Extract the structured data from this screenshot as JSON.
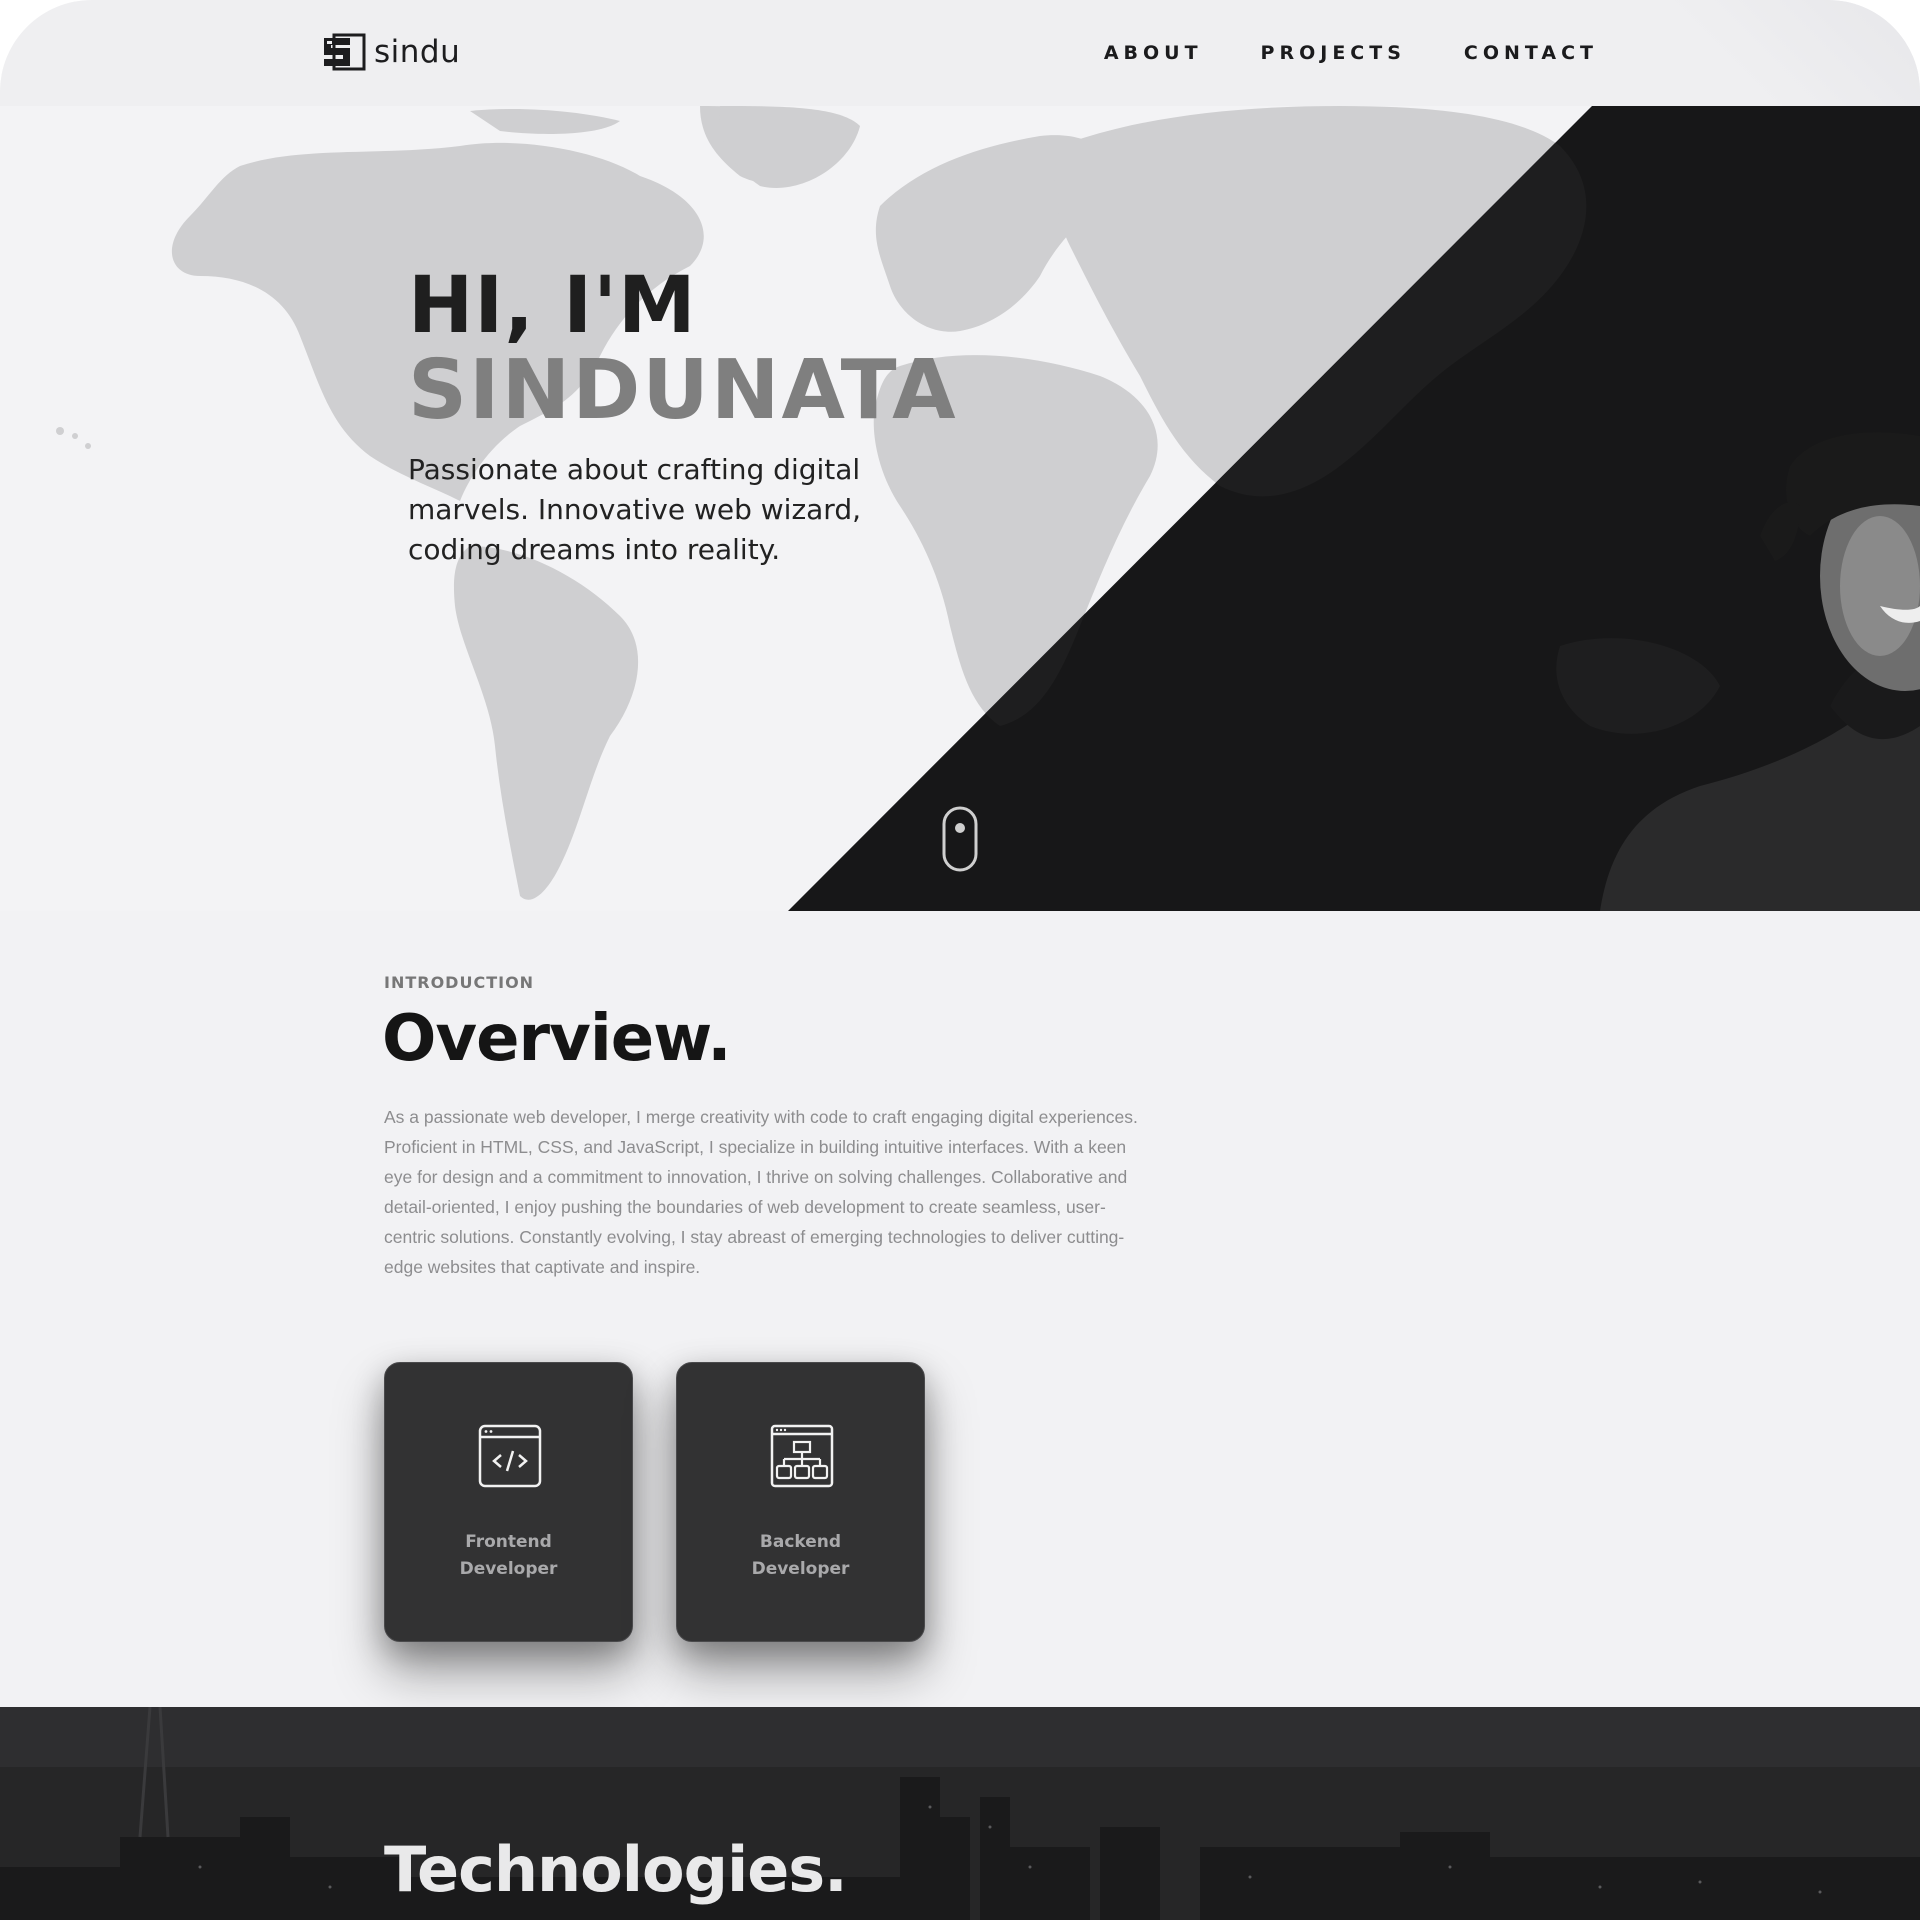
{
  "brand": {
    "name": "sindu",
    "logo_letter": "S"
  },
  "nav": {
    "links": [
      {
        "label": "ABOUT"
      },
      {
        "label": "PROJECTS"
      },
      {
        "label": "CONTACT"
      }
    ]
  },
  "hero": {
    "greeting": "HI, I'M",
    "name": "SINDUNATA",
    "tagline": "Passionate about crafting digital marvels. Innovative web wizard, coding dreams into reality."
  },
  "overview": {
    "label": "INTRODUCTION",
    "title": "Overview.",
    "body": "As a passionate web developer, I merge creativity with code to craft engaging digital experiences. Proficient in HTML, CSS, and JavaScript, I specialize in building intuitive interfaces. With a keen eye for design and a commitment to innovation, I thrive on solving challenges. Collaborative and detail-oriented, I enjoy pushing the boundaries of web development to create seamless, user-centric solutions. Constantly evolving, I stay abreast of emerging technologies to deliver cutting-edge websites that captivate and inspire.",
    "cards": [
      {
        "label": "Frontend Developer",
        "icon": "code-window-icon"
      },
      {
        "label": "Backend Developer",
        "icon": "sitemap-window-icon"
      }
    ]
  },
  "technologies": {
    "title": "Technologies."
  },
  "colors": {
    "background": "#f2f2f4",
    "dark_panel": "#171718",
    "text_primary": "#1f1f1f",
    "text_muted": "#8d8d8f",
    "card": "#323233"
  }
}
